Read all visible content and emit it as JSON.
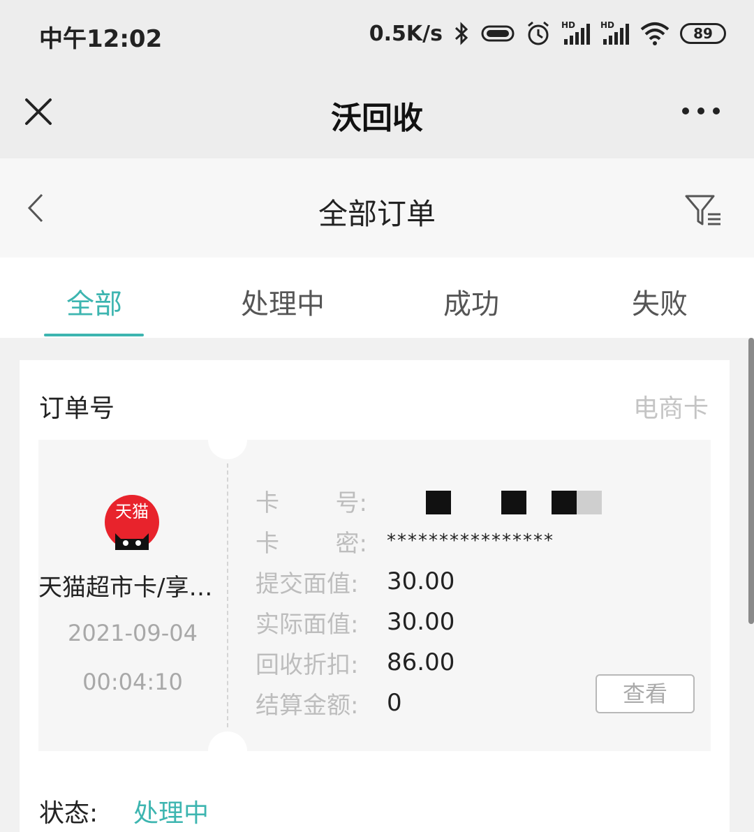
{
  "status_bar": {
    "time": "中午12:02",
    "net_speed": "0.5K/s",
    "battery": "89",
    "icons": [
      "bluetooth-icon",
      "vibrate-icon",
      "alarm-icon",
      "hd-signal-icon",
      "hd-signal-icon",
      "wifi-icon",
      "battery-icon"
    ]
  },
  "titlebar": {
    "title": "沃回收",
    "close_icon": "close-icon",
    "more_icon": "more-dots-icon"
  },
  "header": {
    "title": "全部订单",
    "back_icon": "chevron-left-icon",
    "filter_icon": "filter-icon"
  },
  "tabs": [
    {
      "label": "全部",
      "active": true
    },
    {
      "label": "处理中",
      "active": false
    },
    {
      "label": "成功",
      "active": false
    },
    {
      "label": "失败",
      "active": false
    }
  ],
  "order": {
    "order_label": "订单号",
    "card_type": "电商卡",
    "brand_text": "天猫",
    "product_name": "天猫超市卡/享…",
    "date": "2021-09-04",
    "time": "00:04:10",
    "fields": {
      "card_no_label_1": "卡",
      "card_no_label_2": "号:",
      "card_pwd_label_1": "卡",
      "card_pwd_label_2": "密:",
      "card_pwd_value": "****************",
      "submitted_label": "提交面值:",
      "submitted_value": "30.00",
      "actual_label": "实际面值:",
      "actual_value": "30.00",
      "discount_label": "回收折扣:",
      "discount_value": "86.00",
      "settlement_label": "结算金额:",
      "settlement_value": "0"
    },
    "view_button": "查看",
    "status_label": "状态:",
    "status_value": "处理中"
  },
  "colors": {
    "accent": "#3db5b0",
    "brand_red": "#e8232c"
  }
}
